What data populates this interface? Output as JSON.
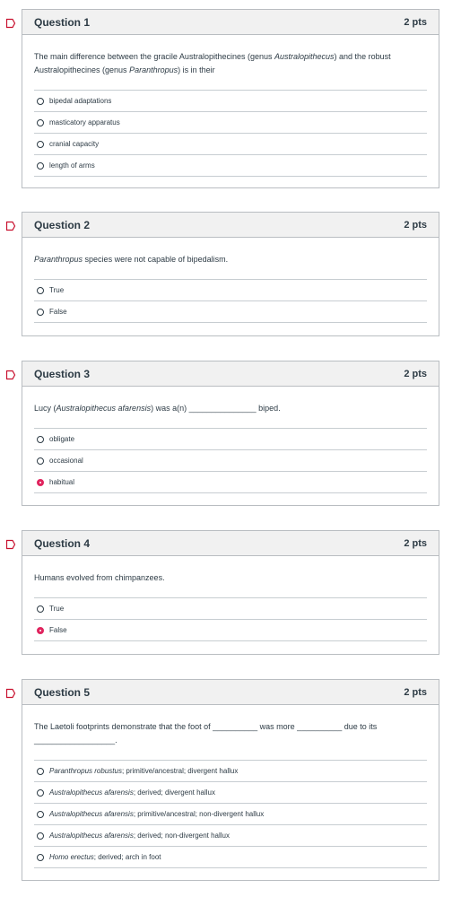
{
  "colors": {
    "accent": "#e0245e",
    "header_bg": "#f1f1f1",
    "border": "#b9bdc1"
  },
  "questions": [
    {
      "title": "Question 1",
      "points": "2 pts",
      "text_parts": [
        {
          "t": "The main difference between the gracile Australopithecines (genus ",
          "i": false
        },
        {
          "t": "Australopithecus",
          "i": true
        },
        {
          "t": ") and the robust Australopithecines (genus ",
          "i": false
        },
        {
          "t": "Paranthropus",
          "i": true
        },
        {
          "t": ") is in their",
          "i": false
        }
      ],
      "answers": [
        {
          "parts": [
            {
              "t": "bipedal adaptations",
              "i": false
            }
          ],
          "selected": false
        },
        {
          "parts": [
            {
              "t": "masticatory apparatus",
              "i": false
            }
          ],
          "selected": false
        },
        {
          "parts": [
            {
              "t": "cranial capacity",
              "i": false
            }
          ],
          "selected": false
        },
        {
          "parts": [
            {
              "t": "length of arms",
              "i": false
            }
          ],
          "selected": false
        }
      ]
    },
    {
      "title": "Question 2",
      "points": "2 pts",
      "text_parts": [
        {
          "t": "Paranthropus",
          "i": true
        },
        {
          "t": " species were not capable of bipedalism.",
          "i": false
        }
      ],
      "answers": [
        {
          "parts": [
            {
              "t": "True",
              "i": false
            }
          ],
          "selected": false
        },
        {
          "parts": [
            {
              "t": "False",
              "i": false
            }
          ],
          "selected": false
        }
      ]
    },
    {
      "title": "Question 3",
      "points": "2 pts",
      "text_parts": [
        {
          "t": "Lucy (",
          "i": false
        },
        {
          "t": "Australopithecus afarensis",
          "i": true
        },
        {
          "t": ") was a(n) _______________ biped.",
          "i": false
        }
      ],
      "answers": [
        {
          "parts": [
            {
              "t": "obligate",
              "i": false
            }
          ],
          "selected": false
        },
        {
          "parts": [
            {
              "t": "occasional",
              "i": false
            }
          ],
          "selected": false
        },
        {
          "parts": [
            {
              "t": "habitual",
              "i": false
            }
          ],
          "selected": true
        }
      ]
    },
    {
      "title": "Question 4",
      "points": "2 pts",
      "text_parts": [
        {
          "t": "Humans evolved from chimpanzees.",
          "i": false
        }
      ],
      "answers": [
        {
          "parts": [
            {
              "t": "True",
              "i": false
            }
          ],
          "selected": false
        },
        {
          "parts": [
            {
              "t": "False",
              "i": false
            }
          ],
          "selected": true
        }
      ]
    },
    {
      "title": "Question 5",
      "points": "2 pts",
      "text_parts": [
        {
          "t": "The Laetoli footprints demonstrate that the foot of __________ was more __________ due to its __________________.",
          "i": false
        }
      ],
      "answers": [
        {
          "parts": [
            {
              "t": "Paranthropus robustus",
              "i": true
            },
            {
              "t": "; primitive/ancestral; divergent hallux",
              "i": false
            }
          ],
          "selected": false
        },
        {
          "parts": [
            {
              "t": "Australopithecus afarensis",
              "i": true
            },
            {
              "t": "; derived; divergent hallux",
              "i": false
            }
          ],
          "selected": false
        },
        {
          "parts": [
            {
              "t": "Australopithecus afarensis",
              "i": true
            },
            {
              "t": "; primitive/ancestral; non-divergent hallux",
              "i": false
            }
          ],
          "selected": false
        },
        {
          "parts": [
            {
              "t": "Australopithecus afarensis",
              "i": true
            },
            {
              "t": "; derived; non-divergent hallux",
              "i": false
            }
          ],
          "selected": false
        },
        {
          "parts": [
            {
              "t": "Homo erectus",
              "i": true
            },
            {
              "t": "; derived; arch in foot",
              "i": false
            }
          ],
          "selected": false
        }
      ]
    }
  ]
}
